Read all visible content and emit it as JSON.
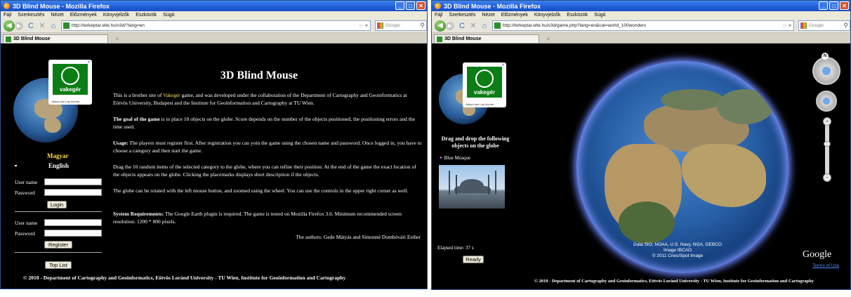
{
  "left": {
    "title": "3D Blind Mouse - Mozilla Firefox",
    "menu": [
      "Fájl",
      "Szerkesztés",
      "Nézet",
      "Előzmények",
      "Könyvjelzők",
      "Eszközök",
      "Súgó"
    ],
    "url": "http://terkeptar.elte.hu/v3d/?lang=en",
    "search_placeholder": "Google",
    "tab": "3D Blind Mouse",
    "logo": {
      "text": "vakegér",
      "small": "Játszd alm Lap  Ikontár"
    },
    "heading": "3D Blind Mouse",
    "intro_a": "This is a brother site of ",
    "intro_link": "Vakegér",
    "intro_b": " game, and was developed under the collaboration of the Department of Cartography and Geoinformatics at Eötvös University, Budapest and the Institute for Geoinformation and Cartography at TU Wien.",
    "goal_bold": "The goal of the game",
    "goal_text": " is to place 10 objects on the globe. Score depends on the number of the objects positioned, the positioning errors and the time used.",
    "usage_bold": "Usage:",
    "usage_text": " The players must register first. After registration you can yoin the game using the chosen name and password. Once logged in, you have to choose a category and then start the game.",
    "drag_text": "Drag the 10 random items of the selected category to the globe, where you can refine their position. At the end of the game the exact location of the objects appears on the globe. Clicking the placemarks displays short description if the objects.",
    "rotate_text": "The globe can be rotated with the left mouse button, and zoomed using the wheel. You can use the controls in the upper right corner as well.",
    "sys_bold": "System Requirements:",
    "sys_text": " The Google Earth plugin is required. The game is tested on Mozilla Firefox 3.6. Minimum recommended screen resolution: 1200 * 800 pixels.",
    "authors": "The authors: Gede Mátyás and Simonné Dombóvári Esther",
    "lang_hu": "Magyar",
    "lang_en": "English",
    "login": {
      "user_label": "User name",
      "pass_label": "Password",
      "button": "Login"
    },
    "register": {
      "user_label": "User name",
      "pass_label": "Password",
      "button": "Register"
    },
    "toplist": "Top List",
    "footer": "© 2010 - Department of Cartography and Geoinformatics, Eötvös Loránd University - TU Wien, Institute for Geoinformation and Cartography"
  },
  "right": {
    "title": "3D Blind Mouse - Mozilla Firefox",
    "menu": [
      "Fájl",
      "Szerkesztés",
      "Nézet",
      "Előzmények",
      "Könyvjelzők",
      "Eszközök",
      "Súgó"
    ],
    "url": "http://terkeptar.elte.hu/v3d/game.php?lang=en&cat=world_100wonders",
    "search_placeholder": "Google",
    "tab": "3D Blind Mouse",
    "drag_title": "Drag and drop the following objects on the globe",
    "item": "Blue Mosque",
    "elapsed": "Elapsed time: 37 s",
    "ready": "Ready",
    "attribution_1": "Data SIO, NOAA, U.S. Navy, NGA, GEBCO",
    "attribution_2": "Image IBCAO",
    "attribution_3": "© 2011 Cnes/Spot Image",
    "google": "Google",
    "terms": "Terms of Use",
    "footer": "© 2010 - Department of Cartography and Geoinformatics, Eötvös Loránd University - TU Wien, Institute for Geoinformation and Cartography"
  },
  "colors": {
    "link_yellow": "#ffe14a",
    "titlebar_blue": "#1f5ad6",
    "background": "#000000"
  }
}
